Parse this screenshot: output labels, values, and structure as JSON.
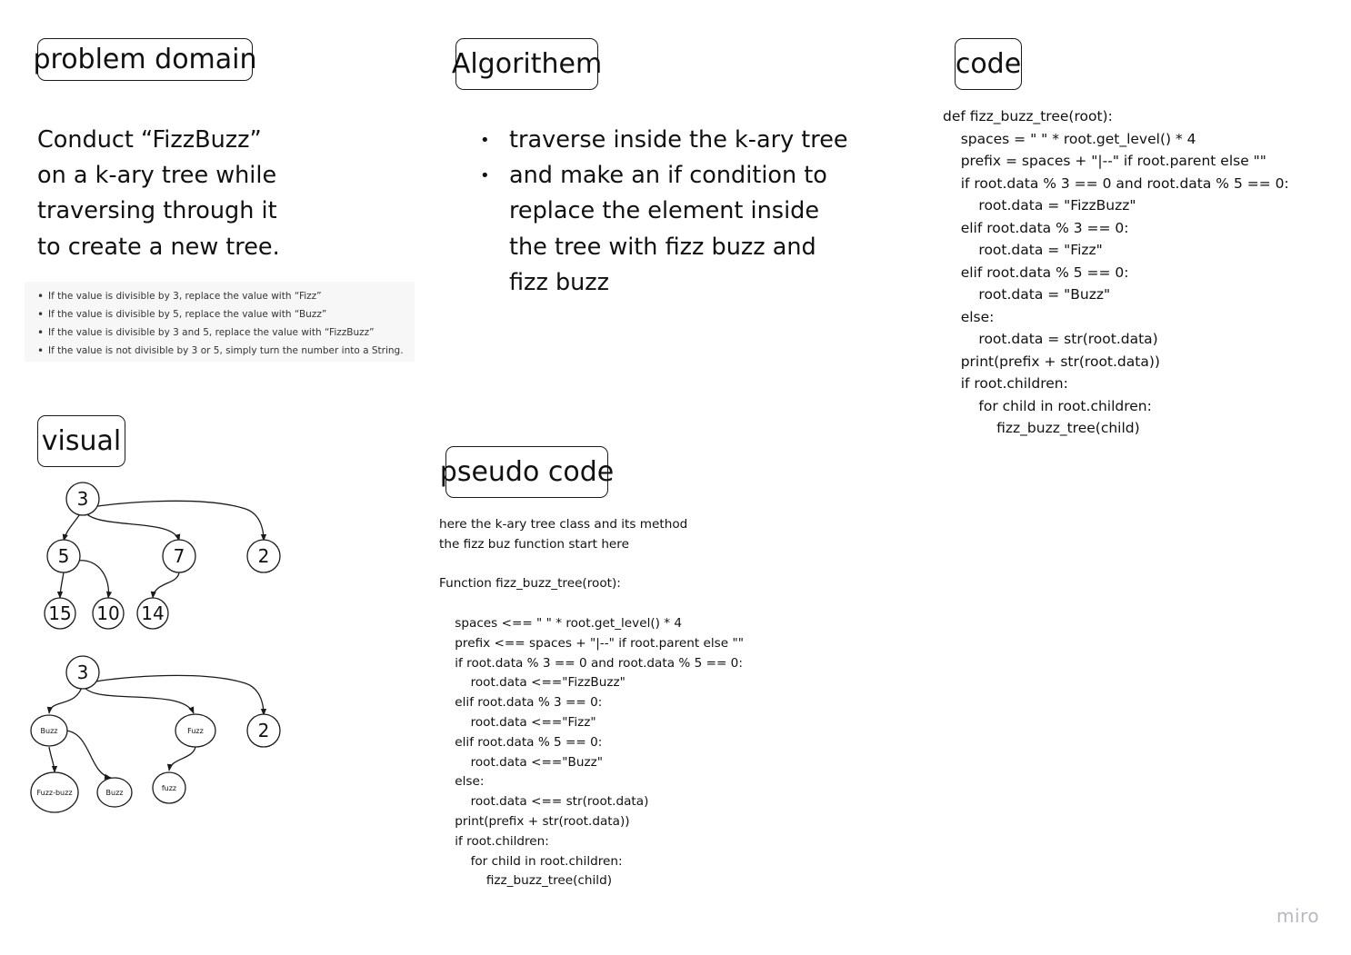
{
  "sections": {
    "problem_domain": {
      "title": "problem domain",
      "description": [
        "Conduct “FizzBuzz”",
        "on a k-ary tree while",
        "traversing through it",
        "to create a new tree."
      ],
      "rules": [
        "If the value is divisible by 3, replace the value with “Fizz”",
        "If the value is divisible by 5, replace the value with “Buzz”",
        "If the value is divisible by 3 and 5, replace the value with “FizzBuzz”",
        "If the value is not divisible by 3 or 5, simply turn the number into a String."
      ]
    },
    "algorithm": {
      "title": "Algorithem",
      "bullets": [
        [
          "traverse inside the k-ary tree"
        ],
        [
          "and make an if condition to",
          "replace the element inside",
          "the tree with fizz buzz and",
          "fizz buzz"
        ]
      ]
    },
    "code": {
      "title": "code",
      "lines": [
        "def fizz_buzz_tree(root):",
        "",
        "    spaces = \" \" * root.get_level() * 4",
        "    prefix = spaces + \"|--\" if root.parent else \"\"",
        "    if root.data % 3 == 0 and root.data % 5 == 0:",
        "        root.data = \"FizzBuzz\"",
        "    elif root.data % 3 == 0:",
        "        root.data = \"Fizz\"",
        "    elif root.data % 5 == 0:",
        "        root.data = \"Buzz\"",
        "    else:",
        "        root.data = str(root.data)",
        "    print(prefix + str(root.data))",
        "    if root.children:",
        "        for child in root.children:",
        "            fizz_buzz_tree(child)"
      ]
    },
    "visual": {
      "title": "visual",
      "tree_before": {
        "root": "3",
        "level1": [
          "5",
          "7",
          "2"
        ],
        "level2": [
          "15",
          "10",
          "14"
        ]
      },
      "tree_after": {
        "root": "3",
        "level1": [
          "Buzz",
          "Fuzz",
          "2"
        ],
        "level2": [
          "Fuzz-buzz",
          "Buzz",
          "fuzz"
        ]
      }
    },
    "pseudo_code": {
      "title": "pseudo code",
      "lines": [
        "here the k-ary tree class and its method",
        "the fizz buz function start here",
        "",
        "Function fizz_buzz_tree(root):",
        "",
        "    spaces <== \" \" * root.get_level() * 4",
        "    prefix <== spaces + \"|--\" if root.parent else \"\"",
        "    if root.data % 3 == 0 and root.data % 5 == 0:",
        "        root.data <==\"FizzBuzz\"",
        "    elif root.data % 3 == 0:",
        "        root.data <==\"Fizz\"",
        "    elif root.data % 5 == 0:",
        "        root.data <==\"Buzz\"",
        "    else:",
        "        root.data <== str(root.data)",
        "    print(prefix + str(root.data))",
        "    if root.children:",
        "        for child in root.children:",
        "            fizz_buzz_tree(child)"
      ]
    }
  },
  "branding": {
    "logo_text": "miro"
  },
  "colors": {
    "ink": "#1a1a1a",
    "rules_background": "#f7f7f7",
    "logo": "#b8b8bf"
  }
}
